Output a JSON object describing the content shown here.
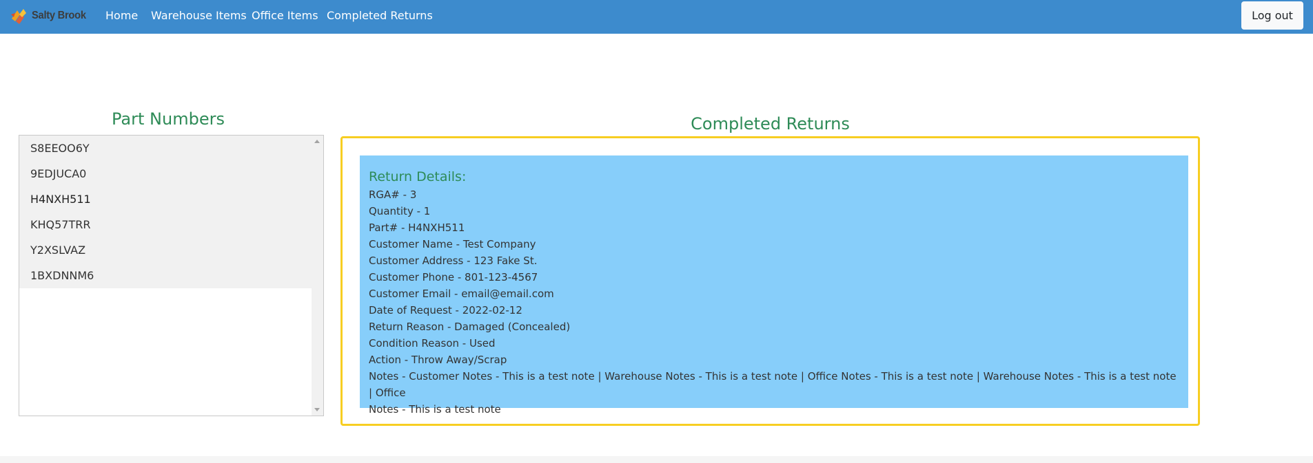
{
  "app": {
    "brand": "Salty Brook"
  },
  "nav": {
    "items": [
      {
        "label": "Home"
      },
      {
        "label": "Warehouse Items"
      },
      {
        "label": "Office Items"
      },
      {
        "label": "Completed Returns"
      }
    ],
    "logout_label": "Log out"
  },
  "parts": {
    "heading": "Part Numbers",
    "items": [
      "S8EEOO6Y",
      "9EDJUCA0",
      "H4NXH511",
      "KHQ57TRR",
      "Y2XSLVAZ",
      "1BXDNNM6"
    ],
    "selected": "H4NXH511"
  },
  "returns": {
    "heading": "Completed Returns",
    "details_title": "Return Details:",
    "lines": [
      "RGA# - 3",
      "Quantity - 1",
      "Part# - H4NXH511",
      "Customer Name - Test Company",
      "Customer Address - 123 Fake St.",
      "Customer Phone - 801-123-4567",
      "Customer Email - email@email.com",
      "Date of Request - 2022-02-12",
      "Return Reason - Damaged (Concealed)",
      "Condition Reason - Used",
      "Action - Throw Away/Scrap",
      "Notes - Customer Notes - This is a test note | Warehouse Notes - This is a test note | Office Notes - This is a test note | Warehouse Notes - This is a test note | Office",
      "Notes - This is a test note"
    ]
  },
  "colors": {
    "navbar": "#3d8bcd",
    "heading": "#2e8b57",
    "details_bg": "#87cefa",
    "box_border": "#f7ce22"
  },
  "icons": {
    "brand_logo": "salty-brook-logo-icon",
    "scroll_up": "scroll-up-arrow-icon",
    "scroll_down": "scroll-down-arrow-icon"
  }
}
